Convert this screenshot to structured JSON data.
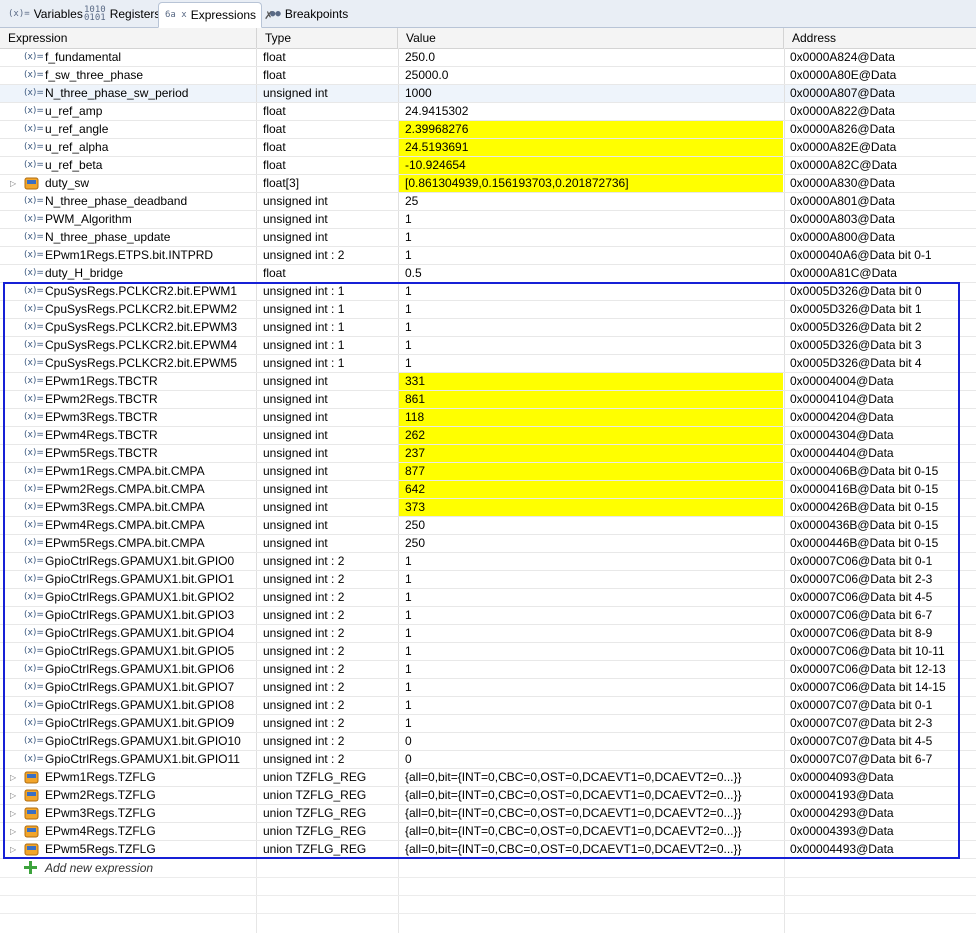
{
  "tabs": [
    {
      "label": "Variables",
      "icon": "(x)=",
      "icon_name": "variables-icon"
    },
    {
      "label": "Registers",
      "icon": "1010\n0101",
      "icon_name": "registers-icon"
    },
    {
      "label": "Expressions",
      "icon": "6a x",
      "icon_name": "expressions-icon",
      "active": true,
      "close": "✗"
    },
    {
      "label": "Breakpoints",
      "icon": "●●",
      "icon_name": "breakpoints-icon"
    }
  ],
  "columns": {
    "expression": "Expression",
    "type": "Type",
    "value": "Value",
    "address": "Address"
  },
  "rows": [
    {
      "expr": "f_fundamental",
      "type": "float",
      "value": "250.0",
      "addr": "0x0000A824@Data"
    },
    {
      "expr": "f_sw_three_phase",
      "type": "float",
      "value": "25000.0",
      "addr": "0x0000A80E@Data"
    },
    {
      "expr": "N_three_phase_sw_period",
      "type": "unsigned int",
      "value": "1000",
      "addr": "0x0000A807@Data",
      "selected": true
    },
    {
      "expr": "u_ref_amp",
      "type": "float",
      "value": "24.9415302",
      "addr": "0x0000A822@Data"
    },
    {
      "expr": "u_ref_angle",
      "type": "float",
      "value": "2.39968276",
      "addr": "0x0000A826@Data",
      "hl": true
    },
    {
      "expr": "u_ref_alpha",
      "type": "float",
      "value": "24.5193691",
      "addr": "0x0000A82E@Data",
      "hl": true
    },
    {
      "expr": "u_ref_beta",
      "type": "float",
      "value": "-10.924654",
      "addr": "0x0000A82C@Data",
      "hl": true
    },
    {
      "expr": "duty_sw",
      "type": "float[3]",
      "value": "[0.861304939,0.156193703,0.201872736]",
      "addr": "0x0000A830@Data",
      "hl": true,
      "struct": true
    },
    {
      "expr": "N_three_phase_deadband",
      "type": "unsigned int",
      "value": "25",
      "addr": "0x0000A801@Data"
    },
    {
      "expr": "PWM_Algorithm",
      "type": "unsigned int",
      "value": "1",
      "addr": "0x0000A803@Data"
    },
    {
      "expr": "N_three_phase_update",
      "type": "unsigned int",
      "value": "1",
      "addr": "0x0000A800@Data"
    },
    {
      "expr": "EPwm1Regs.ETPS.bit.INTPRD",
      "type": "unsigned int : 2",
      "value": "1",
      "addr": "0x000040A6@Data bit 0-1"
    },
    {
      "expr": "duty_H_bridge",
      "type": "float",
      "value": "0.5",
      "addr": "0x0000A81C@Data"
    },
    {
      "expr": "CpuSysRegs.PCLKCR2.bit.EPWM1",
      "type": "unsigned int : 1",
      "value": "1",
      "addr": "0x0005D326@Data bit 0"
    },
    {
      "expr": "CpuSysRegs.PCLKCR2.bit.EPWM2",
      "type": "unsigned int : 1",
      "value": "1",
      "addr": "0x0005D326@Data bit 1"
    },
    {
      "expr": "CpuSysRegs.PCLKCR2.bit.EPWM3",
      "type": "unsigned int : 1",
      "value": "1",
      "addr": "0x0005D326@Data bit 2"
    },
    {
      "expr": "CpuSysRegs.PCLKCR2.bit.EPWM4",
      "type": "unsigned int : 1",
      "value": "1",
      "addr": "0x0005D326@Data bit 3"
    },
    {
      "expr": "CpuSysRegs.PCLKCR2.bit.EPWM5",
      "type": "unsigned int : 1",
      "value": "1",
      "addr": "0x0005D326@Data bit 4"
    },
    {
      "expr": "EPwm1Regs.TBCTR",
      "type": "unsigned int",
      "value": "331",
      "addr": "0x00004004@Data",
      "hl": true
    },
    {
      "expr": "EPwm2Regs.TBCTR",
      "type": "unsigned int",
      "value": "861",
      "addr": "0x00004104@Data",
      "hl": true
    },
    {
      "expr": "EPwm3Regs.TBCTR",
      "type": "unsigned int",
      "value": "118",
      "addr": "0x00004204@Data",
      "hl": true
    },
    {
      "expr": "EPwm4Regs.TBCTR",
      "type": "unsigned int",
      "value": "262",
      "addr": "0x00004304@Data",
      "hl": true
    },
    {
      "expr": "EPwm5Regs.TBCTR",
      "type": "unsigned int",
      "value": "237",
      "addr": "0x00004404@Data",
      "hl": true
    },
    {
      "expr": "EPwm1Regs.CMPA.bit.CMPA",
      "type": "unsigned int",
      "value": "877",
      "addr": "0x0000406B@Data bit 0-15",
      "hl": true
    },
    {
      "expr": "EPwm2Regs.CMPA.bit.CMPA",
      "type": "unsigned int",
      "value": "642",
      "addr": "0x0000416B@Data bit 0-15",
      "hl": true
    },
    {
      "expr": "EPwm3Regs.CMPA.bit.CMPA",
      "type": "unsigned int",
      "value": "373",
      "addr": "0x0000426B@Data bit 0-15",
      "hl": true
    },
    {
      "expr": "EPwm4Regs.CMPA.bit.CMPA",
      "type": "unsigned int",
      "value": "250",
      "addr": "0x0000436B@Data bit 0-15"
    },
    {
      "expr": "EPwm5Regs.CMPA.bit.CMPA",
      "type": "unsigned int",
      "value": "250",
      "addr": "0x0000446B@Data bit 0-15"
    },
    {
      "expr": "GpioCtrlRegs.GPAMUX1.bit.GPIO0",
      "type": "unsigned int : 2",
      "value": "1",
      "addr": "0x00007C06@Data bit 0-1"
    },
    {
      "expr": "GpioCtrlRegs.GPAMUX1.bit.GPIO1",
      "type": "unsigned int : 2",
      "value": "1",
      "addr": "0x00007C06@Data bit 2-3"
    },
    {
      "expr": "GpioCtrlRegs.GPAMUX1.bit.GPIO2",
      "type": "unsigned int : 2",
      "value": "1",
      "addr": "0x00007C06@Data bit 4-5"
    },
    {
      "expr": "GpioCtrlRegs.GPAMUX1.bit.GPIO3",
      "type": "unsigned int : 2",
      "value": "1",
      "addr": "0x00007C06@Data bit 6-7"
    },
    {
      "expr": "GpioCtrlRegs.GPAMUX1.bit.GPIO4",
      "type": "unsigned int : 2",
      "value": "1",
      "addr": "0x00007C06@Data bit 8-9"
    },
    {
      "expr": "GpioCtrlRegs.GPAMUX1.bit.GPIO5",
      "type": "unsigned int : 2",
      "value": "1",
      "addr": "0x00007C06@Data bit 10-11"
    },
    {
      "expr": "GpioCtrlRegs.GPAMUX1.bit.GPIO6",
      "type": "unsigned int : 2",
      "value": "1",
      "addr": "0x00007C06@Data bit 12-13"
    },
    {
      "expr": "GpioCtrlRegs.GPAMUX1.bit.GPIO7",
      "type": "unsigned int : 2",
      "value": "1",
      "addr": "0x00007C06@Data bit 14-15"
    },
    {
      "expr": "GpioCtrlRegs.GPAMUX1.bit.GPIO8",
      "type": "unsigned int : 2",
      "value": "1",
      "addr": "0x00007C07@Data bit 0-1"
    },
    {
      "expr": "GpioCtrlRegs.GPAMUX1.bit.GPIO9",
      "type": "unsigned int : 2",
      "value": "1",
      "addr": "0x00007C07@Data bit 2-3"
    },
    {
      "expr": "GpioCtrlRegs.GPAMUX1.bit.GPIO10",
      "type": "unsigned int : 2",
      "value": "0",
      "addr": "0x00007C07@Data bit 4-5"
    },
    {
      "expr": "GpioCtrlRegs.GPAMUX1.bit.GPIO11",
      "type": "unsigned int : 2",
      "value": "0",
      "addr": "0x00007C07@Data bit 6-7"
    },
    {
      "expr": "EPwm1Regs.TZFLG",
      "type": "union TZFLG_REG",
      "value": "{all=0,bit={INT=0,CBC=0,OST=0,DCAEVT1=0,DCAEVT2=0...}}",
      "addr": "0x00004093@Data",
      "struct": true
    },
    {
      "expr": "EPwm2Regs.TZFLG",
      "type": "union TZFLG_REG",
      "value": "{all=0,bit={INT=0,CBC=0,OST=0,DCAEVT1=0,DCAEVT2=0...}}",
      "addr": "0x00004193@Data",
      "struct": true
    },
    {
      "expr": "EPwm3Regs.TZFLG",
      "type": "union TZFLG_REG",
      "value": "{all=0,bit={INT=0,CBC=0,OST=0,DCAEVT1=0,DCAEVT2=0...}}",
      "addr": "0x00004293@Data",
      "struct": true
    },
    {
      "expr": "EPwm4Regs.TZFLG",
      "type": "union TZFLG_REG",
      "value": "{all=0,bit={INT=0,CBC=0,OST=0,DCAEVT1=0,DCAEVT2=0...}}",
      "addr": "0x00004393@Data",
      "struct": true
    },
    {
      "expr": "EPwm5Regs.TZFLG",
      "type": "union TZFLG_REG",
      "value": "{all=0,bit={INT=0,CBC=0,OST=0,DCAEVT1=0,DCAEVT2=0...}}",
      "addr": "0x00004493@Data",
      "struct": true
    }
  ],
  "icons": {
    "expr_icon": "(x)=",
    "expand_icon": "▷",
    "struct_icon": "struct-icon",
    "add_icon": "add-icon"
  },
  "add_expression": "Add new expression",
  "colors": {
    "highlight": "#ffff00",
    "selection_box": "#1620d6",
    "selected_row": "#eef4fb"
  }
}
